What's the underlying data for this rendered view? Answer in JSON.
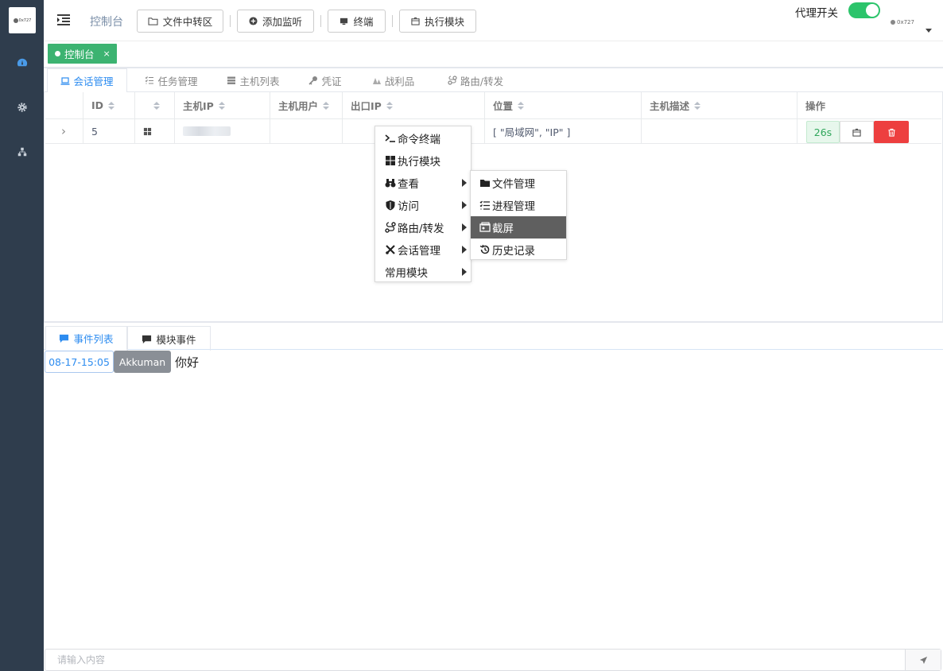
{
  "logo": {
    "text": "0x727"
  },
  "header": {
    "title": "控制台",
    "buttons": {
      "file_transfer": "文件中转区",
      "add_listener": "添加监听",
      "terminal": "终端",
      "execute_module": "执行模块"
    },
    "proxy_label": "代理开关",
    "proxy_enabled": true,
    "user": "0x727"
  },
  "page_tab": {
    "label": "控制台",
    "close": "×"
  },
  "subtabs": [
    "会话管理",
    "任务管理",
    "主机列表",
    "凭证",
    "战利品",
    "路由/转发"
  ],
  "table": {
    "headers": [
      "ID",
      "",
      "主机IP",
      "主机用户",
      "出口IP",
      "位置",
      "主机描述",
      "操作"
    ],
    "row": {
      "expand": "›",
      "id": "5",
      "os": "windows",
      "host_ip": "",
      "host_user": "",
      "exit_ip": "",
      "location": "[ \"局域网\", \"IP\" ]",
      "description": "",
      "heartbeat": "26s"
    }
  },
  "context_menu": {
    "items": [
      "命令终端",
      "执行模块",
      "查看",
      "访问",
      "路由/转发",
      "会话管理",
      "常用模块"
    ],
    "submenu": [
      "文件管理",
      "进程管理",
      "截屏",
      "历史记录"
    ],
    "submenu_active": "截屏"
  },
  "event_tabs": [
    "事件列表",
    "模块事件"
  ],
  "log": {
    "time": "08-17-15:05",
    "user": "Akkuman",
    "message": "你好"
  },
  "input": {
    "placeholder": "请输入内容",
    "value": ""
  },
  "colors": {
    "sidebar": "#2f3d4d",
    "accent": "#2d8cf0",
    "success": "#3cb371",
    "danger": "#ed3f3f",
    "toggle": "#2cc46b"
  }
}
